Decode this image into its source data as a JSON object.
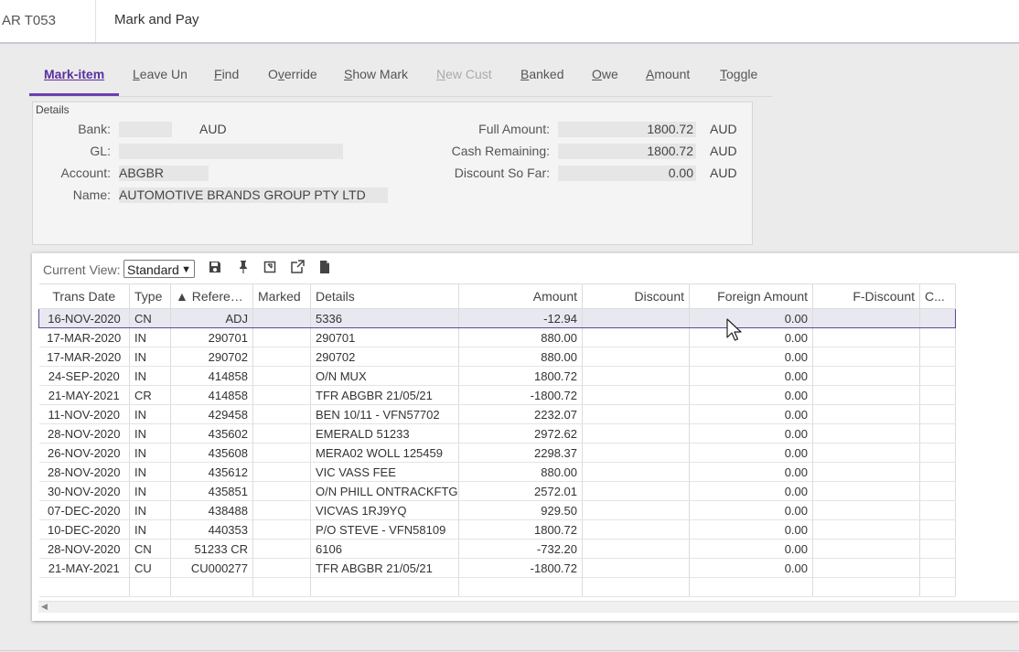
{
  "header": {
    "code": "AR T053",
    "title": "Mark and Pay"
  },
  "tabs": [
    {
      "id": "mark-item",
      "pre": "",
      "u": "M",
      "post": "ark-item",
      "state": "active"
    },
    {
      "id": "leave-un",
      "pre": "",
      "u": "L",
      "post": "eave Un",
      "state": "normal"
    },
    {
      "id": "find",
      "pre": "",
      "u": "F",
      "post": "ind",
      "state": "normal"
    },
    {
      "id": "override",
      "pre": "O",
      "u": "v",
      "post": "erride",
      "state": "normal"
    },
    {
      "id": "show-mark",
      "pre": "",
      "u": "S",
      "post": "how Mark",
      "state": "normal"
    },
    {
      "id": "new-cust",
      "pre": "",
      "u": "N",
      "post": "ew Cust",
      "state": "disabled"
    },
    {
      "id": "banked",
      "pre": "",
      "u": "B",
      "post": "anked",
      "state": "normal"
    },
    {
      "id": "owe",
      "pre": "",
      "u": "O",
      "post": "we",
      "state": "normal"
    },
    {
      "id": "amount",
      "pre": "",
      "u": "A",
      "post": "mount",
      "state": "normal"
    },
    {
      "id": "toggle",
      "pre": "",
      "u": "T",
      "post": "oggle",
      "state": "normal"
    }
  ],
  "details": {
    "legend": "Details",
    "bank_label": "Bank:",
    "bank_value": "",
    "bank_currency": "AUD",
    "gl_label": "GL:",
    "gl_value": "",
    "account_label": "Account:",
    "account_value": "ABGBR",
    "name_label": "Name:",
    "name_value": "AUTOMOTIVE BRANDS GROUP PTY LTD",
    "full_amount_label": "Full Amount:",
    "full_amount_value": "1800.72",
    "full_amount_currency": "AUD",
    "cash_remaining_label": "Cash Remaining:",
    "cash_remaining_value": "1800.72",
    "cash_remaining_currency": "AUD",
    "discount_label": "Discount So Far:",
    "discount_value": "0.00",
    "discount_currency": "AUD"
  },
  "grid": {
    "current_view_label": "Current View:",
    "current_view_value": "Standard",
    "columns": [
      "Trans Date",
      "Type",
      "▲ Referen...",
      "Marked",
      "Details",
      "Amount",
      "Discount",
      "Foreign Amount",
      "F-Discount",
      "C..."
    ],
    "rows": [
      [
        "16-NOV-2020",
        "CN",
        "ADJ",
        "",
        "5336",
        "-12.94",
        "",
        "0.00",
        "",
        ""
      ],
      [
        "17-MAR-2020",
        "IN",
        "290701",
        "",
        "290701",
        "880.00",
        "",
        "0.00",
        "",
        ""
      ],
      [
        "17-MAR-2020",
        "IN",
        "290702",
        "",
        "290702",
        "880.00",
        "",
        "0.00",
        "",
        ""
      ],
      [
        "24-SEP-2020",
        "IN",
        "414858",
        "",
        "O/N MUX",
        "1800.72",
        "",
        "0.00",
        "",
        ""
      ],
      [
        "21-MAY-2021",
        "CR",
        "414858",
        "",
        "TFR ABGBR 21/05/21",
        "-1800.72",
        "",
        "0.00",
        "",
        ""
      ],
      [
        "11-NOV-2020",
        "IN",
        "429458",
        "",
        "BEN 10/11 - VFN57702",
        "2232.07",
        "",
        "0.00",
        "",
        ""
      ],
      [
        "28-NOV-2020",
        "IN",
        "435602",
        "",
        "EMERALD 51233",
        "2972.62",
        "",
        "0.00",
        "",
        ""
      ],
      [
        "26-NOV-2020",
        "IN",
        "435608",
        "",
        "MERA02  WOLL 125459",
        "2298.37",
        "",
        "0.00",
        "",
        ""
      ],
      [
        "28-NOV-2020",
        "IN",
        "435612",
        "",
        "VIC VASS FEE",
        "880.00",
        "",
        "0.00",
        "",
        ""
      ],
      [
        "30-NOV-2020",
        "IN",
        "435851",
        "",
        "O/N PHILL ONTRACKFTG",
        "2572.01",
        "",
        "0.00",
        "",
        ""
      ],
      [
        "07-DEC-2020",
        "IN",
        "438488",
        "",
        "VICVAS 1RJ9YQ",
        "929.50",
        "",
        "0.00",
        "",
        ""
      ],
      [
        "10-DEC-2020",
        "IN",
        "440353",
        "",
        "P/O STEVE - VFN58109",
        "1800.72",
        "",
        "0.00",
        "",
        ""
      ],
      [
        "28-NOV-2020",
        "CN",
        "51233 CR",
        "",
        "6106",
        "-732.20",
        "",
        "0.00",
        "",
        ""
      ],
      [
        "21-MAY-2021",
        "CU",
        "CU000277",
        "",
        "TFR ABGBR 21/05/21",
        "-1800.72",
        "",
        "0.00",
        "",
        ""
      ],
      [
        "",
        "",
        "",
        "",
        "",
        "",
        "",
        "",
        "",
        ""
      ]
    ],
    "selected_row": 0
  }
}
